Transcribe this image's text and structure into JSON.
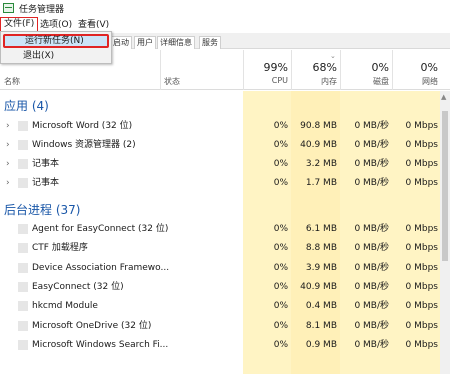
{
  "window": {
    "title": "任务管理器"
  },
  "menu": {
    "file": "文件(F)",
    "options": "选项(O)",
    "view": "查看(V)"
  },
  "file_menu": {
    "new_task": "运行新任务(N)",
    "exit": "退出(X)"
  },
  "tabs": [
    "启动",
    "用户",
    "详细信息",
    "服务"
  ],
  "columns": {
    "name": "名称",
    "status": "状态",
    "cpu_pct": "99%",
    "cpu": "CPU",
    "mem_pct": "68%",
    "mem": "内存",
    "disk_pct": "0%",
    "disk": "磁盘",
    "net_pct": "0%",
    "net": "网络"
  },
  "groups": {
    "apps": {
      "label": "应用 (4)",
      "rows": [
        {
          "name": "Microsoft Word (32 位)",
          "cpu": "0%",
          "mem": "90.8 MB",
          "disk": "0 MB/秒",
          "net": "0 Mbps"
        },
        {
          "name": "Windows 资源管理器 (2)",
          "cpu": "0%",
          "mem": "40.9 MB",
          "disk": "0 MB/秒",
          "net": "0 Mbps"
        },
        {
          "name": "记事本",
          "cpu": "0%",
          "mem": "3.2 MB",
          "disk": "0 MB/秒",
          "net": "0 Mbps"
        },
        {
          "name": "记事本",
          "cpu": "0%",
          "mem": "1.7 MB",
          "disk": "0 MB/秒",
          "net": "0 Mbps"
        }
      ]
    },
    "background": {
      "label": "后台进程 (37)",
      "rows": [
        {
          "name": "Agent for EasyConnect (32 位)",
          "cpu": "0%",
          "mem": "6.1 MB",
          "disk": "0 MB/秒",
          "net": "0 Mbps"
        },
        {
          "name": "CTF 加载程序",
          "cpu": "0%",
          "mem": "8.8 MB",
          "disk": "0 MB/秒",
          "net": "0 Mbps"
        },
        {
          "name": "Device Association Framewo...",
          "cpu": "0%",
          "mem": "3.9 MB",
          "disk": "0 MB/秒",
          "net": "0 Mbps"
        },
        {
          "name": "EasyConnect (32 位)",
          "cpu": "0%",
          "mem": "40.9 MB",
          "disk": "0 MB/秒",
          "net": "0 Mbps"
        },
        {
          "name": "hkcmd Module",
          "cpu": "0%",
          "mem": "0.4 MB",
          "disk": "0 MB/秒",
          "net": "0 Mbps"
        },
        {
          "name": "Microsoft OneDrive (32 位)",
          "cpu": "0%",
          "mem": "8.1 MB",
          "disk": "0 MB/秒",
          "net": "0 Mbps"
        },
        {
          "name": "Microsoft Windows Search Fi...",
          "cpu": "0%",
          "mem": "0.9 MB",
          "disk": "0 MB/秒",
          "net": "0 Mbps"
        }
      ]
    }
  },
  "colors": {
    "accent": "#1a57a8",
    "highlight": "#e02424",
    "heat": "#fff4c4"
  }
}
